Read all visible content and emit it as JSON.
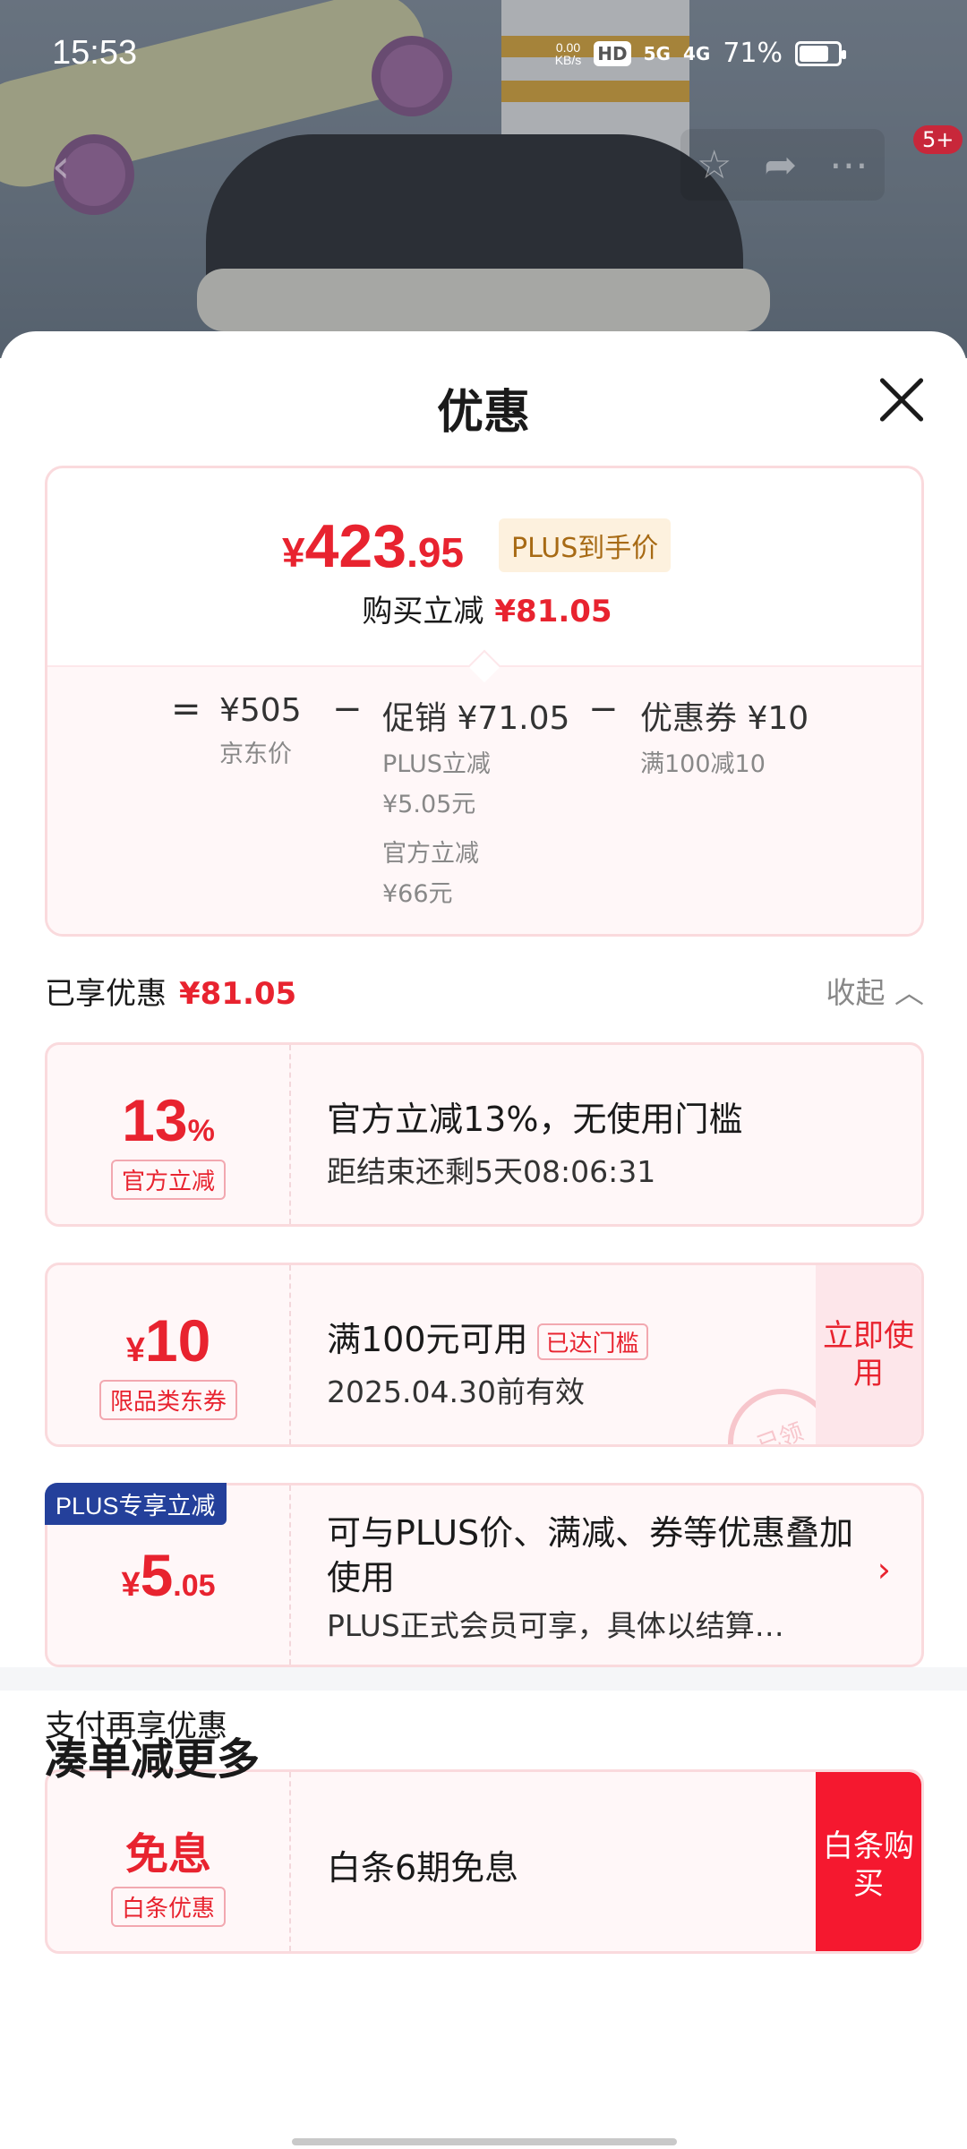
{
  "status_bar": {
    "time": "15:53",
    "net_speed": "0.00",
    "net_unit": "KB/s",
    "hd": "HD",
    "sig1": "5G",
    "sig2": "4G",
    "battery": "71%"
  },
  "nav": {
    "back_icon": "chevron-left-icon",
    "favorite_icon": "star-icon",
    "share_icon": "share-icon",
    "more_icon": "more-icon",
    "badge": "5+"
  },
  "sheet": {
    "title": "优惠",
    "price": {
      "currency": "¥",
      "integer": "423",
      "decimal": ".95",
      "plus_tag": "PLUS到手价",
      "reduce_label": "购买立减",
      "reduce_amount": "¥81.05"
    },
    "breakdown": {
      "eq": "=",
      "jd_price": "¥505",
      "jd_price_label": "京东价",
      "minus1": "−",
      "promo": "促销 ¥71.05",
      "promo_sub1": "PLUS立减",
      "promo_sub2": "¥5.05元",
      "promo_sub3": "官方立减",
      "promo_sub4": "¥66元",
      "minus2": "−",
      "coupon": "优惠券 ¥10",
      "coupon_sub": "满100减10"
    },
    "enjoyed": {
      "label": "已享优惠",
      "amount": "¥81.05",
      "collapse": "收起"
    },
    "coupons": [
      {
        "amount_main": "13",
        "amount_unit": "%",
        "tag": "官方立减",
        "line1": "官方立减13%，无使用门槛",
        "line2": "距结束还剩5天08:06:31"
      },
      {
        "currency": "¥",
        "amount_main": "10",
        "tag": "限品类东券",
        "line1": "满100元可用",
        "threshold": "已达门槛",
        "line2": "2025.04.30前有效",
        "button": "立即使用",
        "stamp": "已领"
      },
      {
        "plus_label": "PLUS专享立减",
        "currency": "¥",
        "amount_main": "5",
        "amount_decimal": ".05",
        "line1": "可与PLUS价、满减、券等优惠叠加使用",
        "line2": "PLUS正式会员可享，具体以结算…"
      }
    ],
    "pay_section": {
      "label": "支付再享优惠",
      "amount": "免息",
      "tag": "白条优惠",
      "line1": "白条6期免息",
      "button": "白条购买"
    },
    "more_title": "凑单减更多"
  },
  "colors": {
    "accent_red": "#e8232f",
    "plus_blue": "#24409b",
    "plus_gold": "#a76a14"
  }
}
